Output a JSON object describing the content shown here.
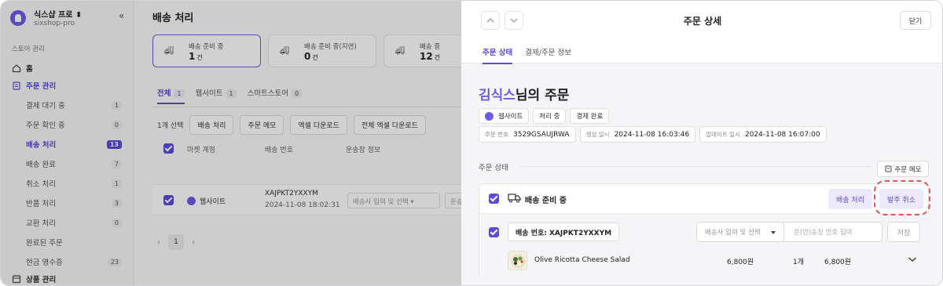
{
  "sidebar": {
    "brand_name": "식스샵 프로 ⬍",
    "brand_sub": "sixshop-pro",
    "collapse_glyph": "«",
    "section": "스토어 관리",
    "home": "홈",
    "orders": "주문 관리",
    "sub_items": [
      {
        "label": "결제 대기 중",
        "count": "1"
      },
      {
        "label": "주문 확인 중",
        "count": "0"
      },
      {
        "label": "배송 처리",
        "count": "13"
      },
      {
        "label": "배송 완료",
        "count": "7"
      },
      {
        "label": "취소 처리",
        "count": "1"
      },
      {
        "label": "반품 처리",
        "count": "3"
      },
      {
        "label": "교환 처리",
        "count": "0"
      },
      {
        "label": "완료된 주문",
        "count": ""
      },
      {
        "label": "현금 영수증",
        "count": "23"
      }
    ],
    "products": "상품 관리"
  },
  "main": {
    "title": "배송 처리",
    "cards": [
      {
        "label": "배송 준비 중",
        "value": "1",
        "unit": "건"
      },
      {
        "label": "배송 준비 중(지연)",
        "value": "0",
        "unit": "건"
      },
      {
        "label": "배송 중",
        "value": "12",
        "unit": "건"
      }
    ],
    "tabs": [
      {
        "label": "전체",
        "count": "1"
      },
      {
        "label": "웹사이트",
        "count": "1"
      },
      {
        "label": "스마트스토어",
        "count": "0"
      }
    ],
    "toolbar": {
      "selected": "1개 선택",
      "btn_ship": "배송 처리",
      "btn_memo": "주문 메모",
      "btn_excel": "엑셀 다운로드",
      "btn_excel_all": "전체 엑셀 다운로드"
    },
    "table_headers": [
      "마켓 계정",
      "배송 번호",
      "운송장 정보"
    ],
    "row": {
      "site": "웹사이트",
      "order_id": "XAJPKT2YXXYM",
      "datetime": "2024-11-08 18:02:31",
      "carrier_placeholder": "배송사 입력 및 선택",
      "tracking_placeholder": "운송"
    },
    "pager": {
      "page": "1"
    }
  },
  "panel": {
    "title": "주문 상세",
    "close_label": "닫기",
    "tabs": [
      "주문 상태",
      "결제/주문 정보"
    ],
    "customer_name": "김식스",
    "order_suffix": "님의 주문",
    "chips": [
      "웹사이트",
      "처리 중",
      "결제 완료"
    ],
    "meta": [
      {
        "key": "주문 번호",
        "value": "3529GSAUJRWA"
      },
      {
        "key": "생성 일시",
        "value": "2024-11-08 16:03:46"
      },
      {
        "key": "업데이트 일시",
        "value": "2024-11-08 16:07:00"
      }
    ],
    "section_title": "주문 상태",
    "memo_btn": "주문 메모",
    "shipment": {
      "status": "배송 준비 중",
      "btn_ship": "배송 처리",
      "btn_cancel": "발주 취소",
      "tracking_label": "배송 번호: XAJPKT2YXXYM",
      "carrier_placeholder": "배송사 입력 및 선택",
      "tracking_placeholder": "운(반)송장 번호 입력",
      "save_label": "저장",
      "item": {
        "name": "Olive Ricotta Cheese Salad",
        "price": "6,800원",
        "qty": "1개",
        "total": "6,800원"
      }
    }
  },
  "colors": {
    "accent": "#6d5ce8",
    "highlight": "#e0555c"
  }
}
